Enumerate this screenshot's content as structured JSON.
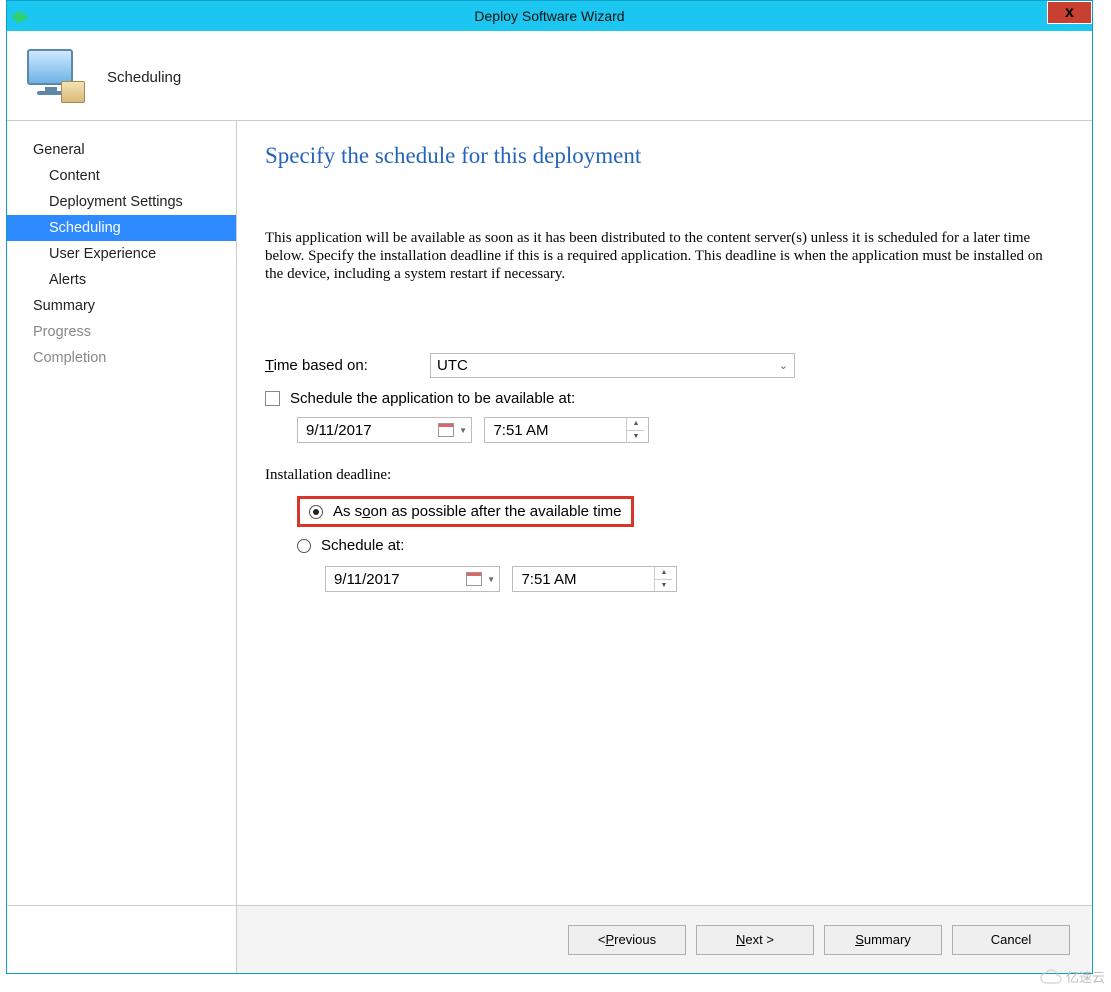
{
  "window": {
    "title": "Deploy Software Wizard",
    "close": "x"
  },
  "header": {
    "title": "Scheduling"
  },
  "sidebar": {
    "items": [
      {
        "label": "General",
        "level": "top",
        "state": "normal"
      },
      {
        "label": "Content",
        "level": "sub",
        "state": "normal"
      },
      {
        "label": "Deployment Settings",
        "level": "sub",
        "state": "normal"
      },
      {
        "label": "Scheduling",
        "level": "sub",
        "state": "selected"
      },
      {
        "label": "User Experience",
        "level": "sub",
        "state": "normal"
      },
      {
        "label": "Alerts",
        "level": "sub",
        "state": "normal"
      },
      {
        "label": "Summary",
        "level": "top",
        "state": "normal"
      },
      {
        "label": "Progress",
        "level": "top",
        "state": "disabled"
      },
      {
        "label": "Completion",
        "level": "top",
        "state": "disabled"
      }
    ]
  },
  "content": {
    "heading": "Specify the schedule for this deployment",
    "description": "This application will be available as soon as it has been distributed to the content server(s) unless it is scheduled for a later time below. Specify the installation deadline if this is a required application. This deadline is when the application must be installed on the device, including a system restart if necessary.",
    "time_based_label": "Time based on:",
    "time_based_value": "UTC",
    "schedule_available_label": "Schedule the application to be available at:",
    "schedule_available_checked": false,
    "available_date": "9/11/2017",
    "available_time": "7:51 AM",
    "deadline_label": "Installation deadline:",
    "deadline_options": {
      "asap_label": "As soon as possible after the available time",
      "schedule_at_label": "Schedule at:",
      "selected": "asap"
    },
    "deadline_date": "9/11/2017",
    "deadline_time": "7:51 AM"
  },
  "footer": {
    "previous": "< Previous",
    "next": "Next >",
    "summary": "Summary",
    "cancel": "Cancel"
  },
  "watermark": "亿速云"
}
